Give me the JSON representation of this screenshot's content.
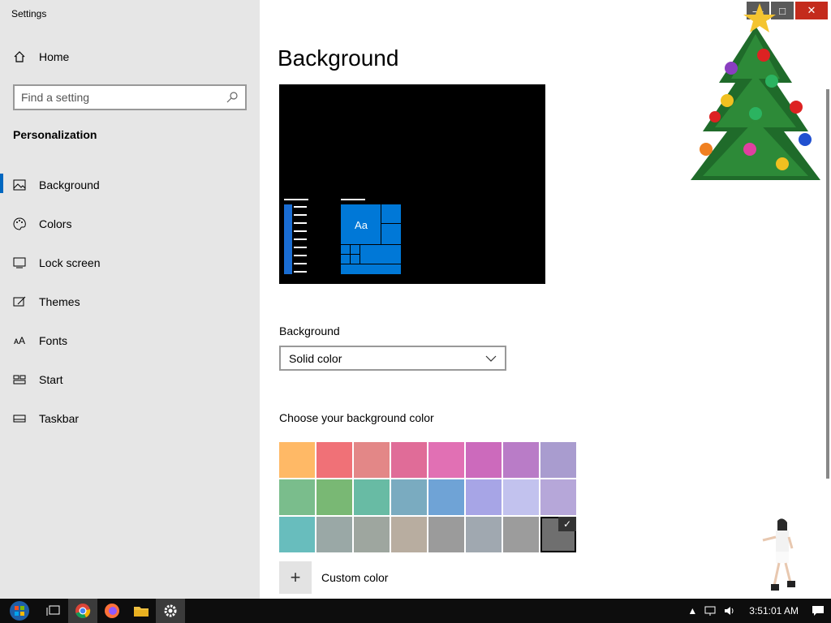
{
  "window": {
    "title": "Settings",
    "controls": {
      "minimize": "—",
      "maximize": "□",
      "close": "✕"
    }
  },
  "sidebar": {
    "home_label": "Home",
    "search_placeholder": "Find a setting",
    "section_title": "Personalization",
    "items": [
      {
        "label": "Background",
        "icon": "picture-icon",
        "active": true
      },
      {
        "label": "Colors",
        "icon": "palette-icon",
        "active": false
      },
      {
        "label": "Lock screen",
        "icon": "lock-screen-icon",
        "active": false
      },
      {
        "label": "Themes",
        "icon": "themes-icon",
        "active": false
      },
      {
        "label": "Fonts",
        "icon": "fonts-icon",
        "active": false
      },
      {
        "label": "Start",
        "icon": "start-icon",
        "active": false
      },
      {
        "label": "Taskbar",
        "icon": "taskbar-icon",
        "active": false
      }
    ]
  },
  "main": {
    "title": "Background",
    "preview": {
      "tile_text": "Aa"
    },
    "background_label": "Background",
    "dropdown_value": "Solid color",
    "choose_label": "Choose your background color",
    "colors": [
      "#ffb966",
      "#f07177",
      "#e38787",
      "#e06c98",
      "#e170b4",
      "#cc6abc",
      "#b97cc7",
      "#a99ccf",
      "#7abd8c",
      "#79b874",
      "#68bba4",
      "#7aabc0",
      "#6fa3d6",
      "#a7a5e6",
      "#c2c2ee",
      "#b6a7d9",
      "#68bdbd",
      "#9aa8a6",
      "#9ea69f",
      "#b8ada0",
      "#9b9b9b",
      "#a0a8b0",
      "#9c9c9c",
      "#6f6f6f"
    ],
    "selected_index": 23,
    "custom_color_label": "Custom color"
  },
  "taskbar": {
    "clock": "3:51:01 AM",
    "apps": [
      "start-orb-icon",
      "task-view-icon",
      "chrome-icon",
      "firefox-icon",
      "file-explorer-icon",
      "settings-gear-icon"
    ]
  }
}
